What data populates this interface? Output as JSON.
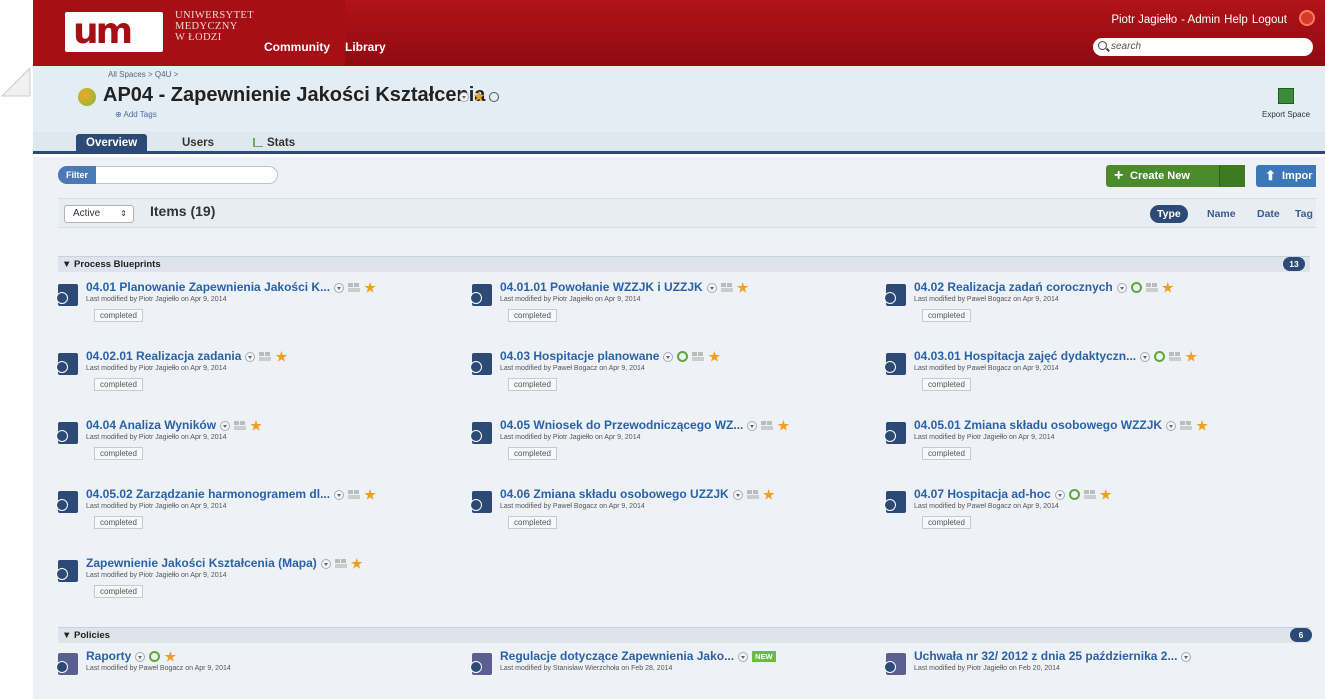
{
  "header": {
    "logo_mark": "um",
    "logo_lines": [
      "UNIWERSYTET",
      "MEDYCZNY",
      "W ŁODZI"
    ],
    "nav": [
      "Community",
      "Library"
    ],
    "user": "Piotr Jagiełło",
    "links": [
      "- Admin",
      "Help",
      "Logout"
    ],
    "search_placeholder": "search"
  },
  "space": {
    "breadcrumb": "All Spaces > Q4U >",
    "title": "AP04 - Zapewnienie Jakości Kształcenia",
    "add_tags": "Add Tags",
    "export_label": "Export Space"
  },
  "tabs": [
    "Overview",
    "Users",
    "Stats"
  ],
  "toolbar": {
    "filter_label": "Filter",
    "create_label": "Create New",
    "import_label": "Impor",
    "status_select": "Active",
    "items_count": "Items (19)",
    "sort": [
      "Type",
      "Name",
      "Date",
      "Tag"
    ]
  },
  "sections": [
    {
      "title": "▼ Process Blueprints",
      "count": "13",
      "items": [
        {
          "title": "04.01 Planowanie Zapewnienia Jakości K...",
          "modified": "Last modified by Piotr Jagiełło on Apr 9, 2014",
          "status": "completed"
        },
        {
          "title": "04.01.01 Powołanie WZZJK i UZZJK",
          "modified": "Last modified by Piotr Jagiełło on Apr 9, 2014",
          "status": "completed"
        },
        {
          "title": "04.02 Realizacja zadań corocznych",
          "modified": "Last modified by Paweł Bogacz on Apr 9, 2014",
          "status": "completed"
        },
        {
          "title": "04.02.01 Realizacja zadania",
          "modified": "Last modified by Piotr Jagiełło on Apr 9, 2014",
          "status": "completed"
        },
        {
          "title": "04.03 Hospitacje planowane",
          "modified": "Last modified by Paweł Bogacz on Apr 9, 2014",
          "status": "completed"
        },
        {
          "title": "04.03.01 Hospitacja zajęć dydaktyczn...",
          "modified": "Last modified by Paweł Bogacz on Apr 9, 2014",
          "status": "completed"
        },
        {
          "title": "04.04 Analiza Wyników",
          "modified": "Last modified by Piotr Jagiełło on Apr 9, 2014",
          "status": "completed"
        },
        {
          "title": "04.05 Wniosek do Przewodniczącego WZ...",
          "modified": "Last modified by Piotr Jagiełło on Apr 9, 2014",
          "status": "completed"
        },
        {
          "title": "04.05.01 Zmiana składu osobowego WZZJK",
          "modified": "Last modified by Piotr Jagiełło on Apr 9, 2014",
          "status": "completed"
        },
        {
          "title": "04.05.02 Zarządzanie harmonogramem dl...",
          "modified": "Last modified by Piotr Jagiełło on Apr 9, 2014",
          "status": "completed"
        },
        {
          "title": "04.06 Zmiana składu osobowego UZZJK",
          "modified": "Last modified by Paweł Bogacz on Apr 9, 2014",
          "status": "completed"
        },
        {
          "title": "04.07 Hospitacja ad-hoc",
          "modified": "Last modified by Paweł Bogacz on Apr 9, 2014",
          "status": "completed"
        },
        {
          "title": "Zapewnienie Jakości Kształcenia (Mapa)",
          "modified": "Last modified by Piotr Jagiełło on Apr 9, 2014",
          "status": "completed"
        }
      ]
    },
    {
      "title": "▼ Policies",
      "count": "6",
      "items": [
        {
          "title": "Raporty",
          "modified": "Last modified by Paweł Bogacz on Apr 9, 2014"
        },
        {
          "title": "Regulacje dotyczące Zapewnienia Jako...",
          "modified": "Last modified by Stanisław Wierzchoła on Feb 28, 2014",
          "badge": "NEW"
        },
        {
          "title": "Uchwała nr 32/ 2012 z dnia 25 października 2...",
          "modified": "Last modified by Piotr Jagiełło on Feb 20, 2014"
        }
      ]
    }
  ]
}
